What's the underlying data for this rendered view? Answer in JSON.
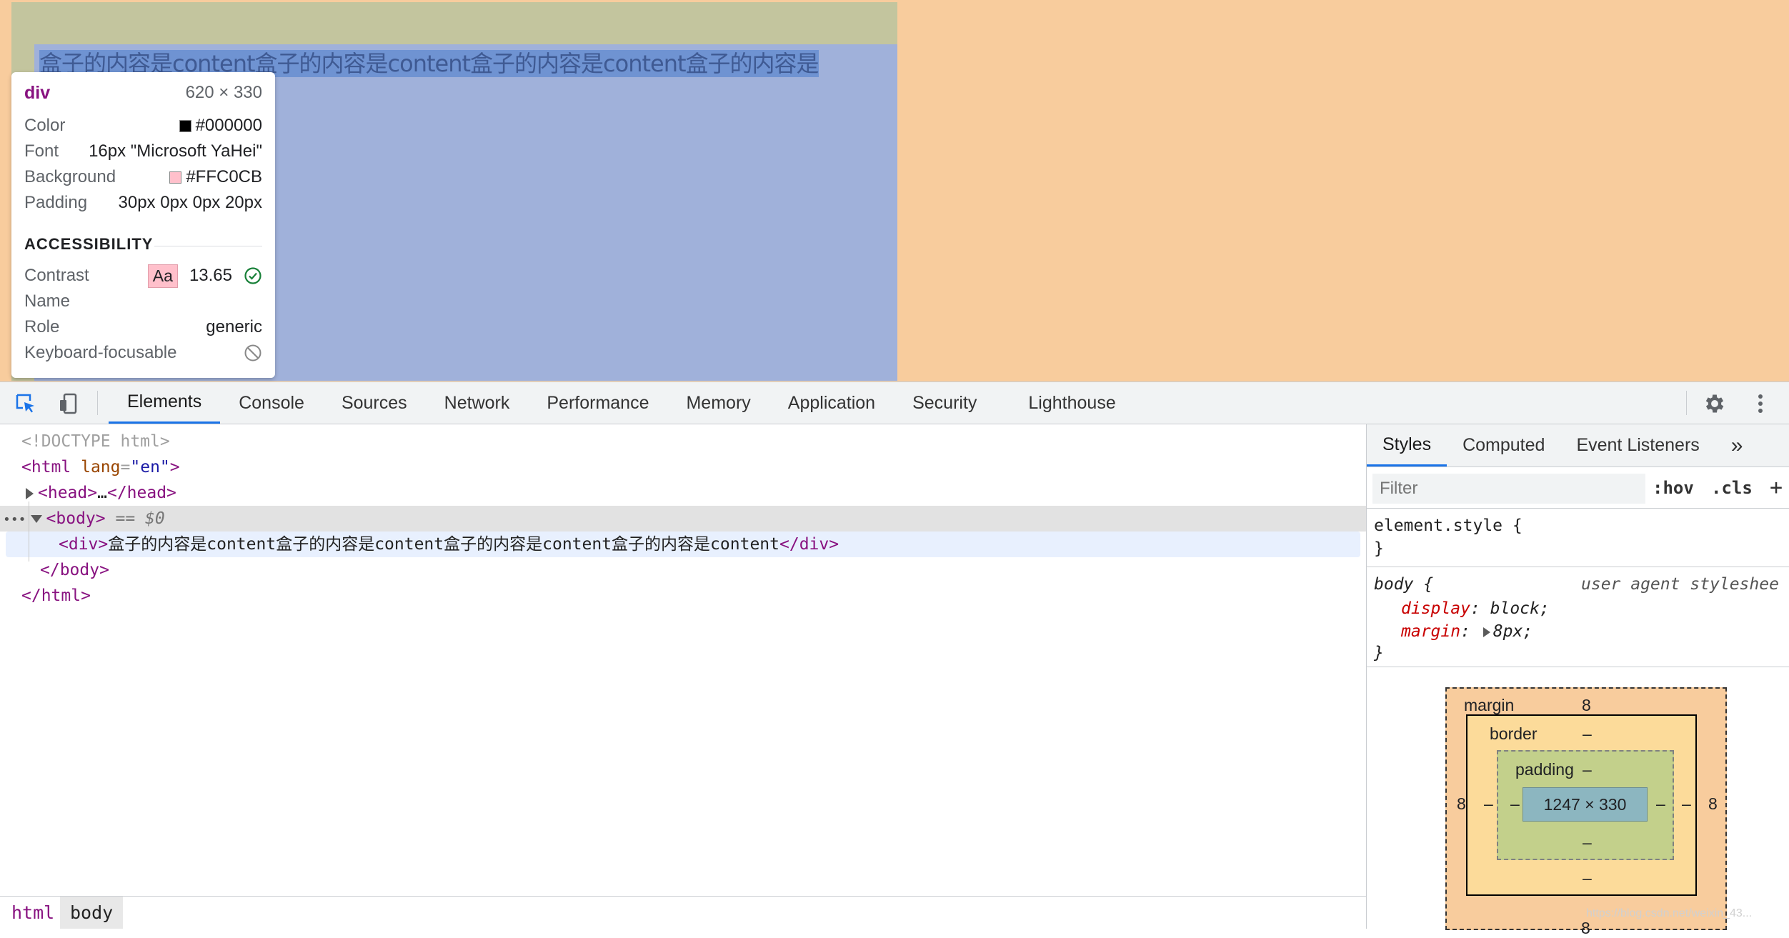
{
  "page": {
    "text": "盒子的内容是content盒子的内容是content盒子的内容是content盒子的内容是"
  },
  "tooltip": {
    "tag": "div",
    "dimensions": "620 × 330",
    "rows": [
      {
        "key": "Color",
        "value": "#000000",
        "swatch": "#000000"
      },
      {
        "key": "Font",
        "value": "16px \"Microsoft YaHei\""
      },
      {
        "key": "Background",
        "value": "#FFC0CB",
        "swatch": "#FFC0CB"
      },
      {
        "key": "Padding",
        "value": "30px 0px 0px 20px"
      }
    ],
    "accessibility_heading": "ACCESSIBILITY",
    "contrast_label": "Contrast",
    "contrast_sample": "Aa",
    "contrast_value": "13.65",
    "name_label": "Name",
    "role_label": "Role",
    "role_value": "generic",
    "focusable_label": "Keyboard-focusable"
  },
  "toolbar": {
    "tabs": [
      "Elements",
      "Console",
      "Sources",
      "Network",
      "Performance",
      "Memory",
      "Application",
      "Security",
      "Lighthouse"
    ],
    "active_tab": "Elements"
  },
  "dom": {
    "doctype": "<!DOCTYPE html>",
    "html_open_tag": "html",
    "html_attr_name": "lang",
    "html_attr_value": "en",
    "head_tag": "head",
    "head_ellipsis": "…",
    "body_tag": "body",
    "body_selected_marker": "== $0",
    "div_tag": "div",
    "div_text": "盒子的内容是content盒子的内容是content盒子的内容是content盒子的内容是content",
    "dots": "•••"
  },
  "breadcrumbs": [
    "html",
    "body"
  ],
  "sidebar": {
    "tabs": [
      "Styles",
      "Computed",
      "Event Listeners"
    ],
    "more": "»",
    "filter_placeholder": "Filter",
    "hov": ":hov",
    "cls": ".cls",
    "add": "+",
    "element_style": "element.style {",
    "close_brace": "}",
    "body_selector": "body {",
    "ua_label": "user agent styleshee",
    "rules": [
      {
        "prop": "display",
        "value": "block;"
      },
      {
        "prop": "margin",
        "value": "8px;"
      }
    ]
  },
  "box_model": {
    "margin_label": "margin",
    "margin_top": "8",
    "margin_left": "8",
    "margin_right": "8",
    "margin_bottom": "8",
    "border_label": "border",
    "border_top": "–",
    "border_left": "–",
    "border_right": "–",
    "border_bottom": "–",
    "padding_label": "padding",
    "padding_top": "–",
    "padding_left": "–",
    "padding_right": "–",
    "padding_bottom": "–",
    "content": "1247 × 330"
  },
  "watermark": "https://blog.csdn.net/weixin_43..."
}
